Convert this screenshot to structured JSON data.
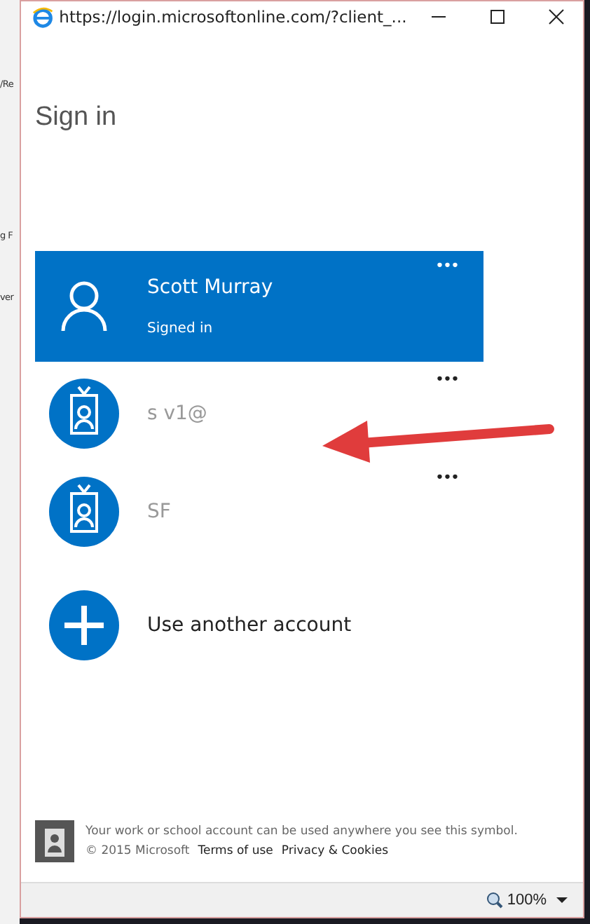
{
  "background_window": {
    "fragments": [
      "/Re",
      "g F",
      "ver"
    ]
  },
  "window": {
    "title": "https://login.microsoftonline.com/?client_..."
  },
  "heading": "Sign in",
  "accounts": [
    {
      "kind": "user",
      "name": "Scott Murray",
      "status": "Signed in",
      "selected": true,
      "menu": "•••"
    },
    {
      "kind": "badge",
      "name": "s      v1@",
      "selected": false,
      "menu": "•••"
    },
    {
      "kind": "badge",
      "name": "SF",
      "selected": false,
      "menu": "•••"
    },
    {
      "kind": "add",
      "name": "Use another account",
      "selected": false
    }
  ],
  "footer": {
    "note": "Your work or school account can be used anywhere you see this symbol.",
    "copyright": "© 2015 Microsoft",
    "links": [
      "Terms of use",
      "Privacy & Cookies"
    ]
  },
  "status_bar": {
    "zoom": "100%"
  }
}
